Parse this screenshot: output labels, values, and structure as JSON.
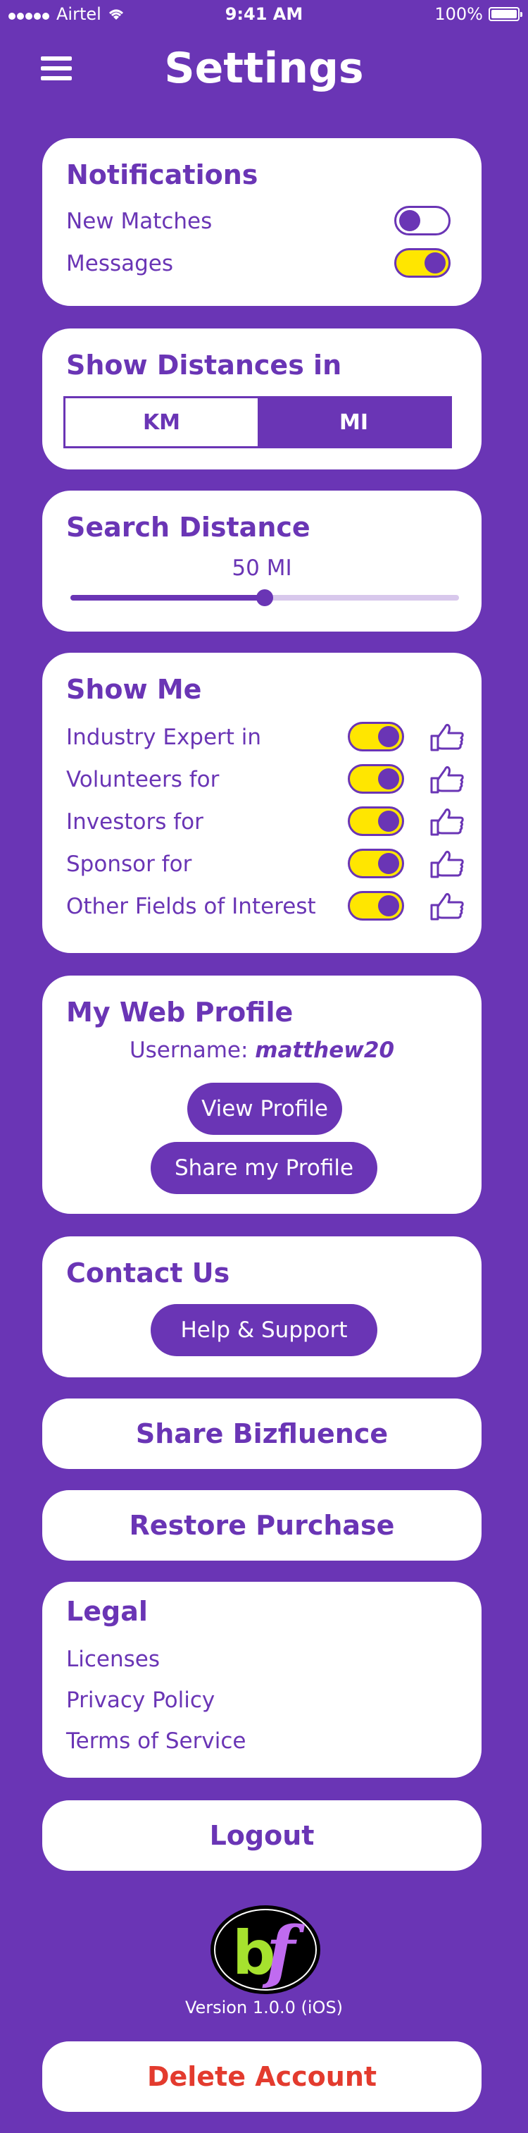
{
  "status_bar": {
    "carrier": "Airtel",
    "time": "9:41 AM",
    "battery": "100%"
  },
  "header": {
    "title": "Settings"
  },
  "notifications": {
    "title": "Notifications",
    "items": [
      {
        "label": "New Matches",
        "enabled": false
      },
      {
        "label": "Messages",
        "enabled": true
      }
    ]
  },
  "distance_units": {
    "title": "Show Distances in",
    "options": [
      "KM",
      "MI"
    ],
    "selected": "MI"
  },
  "search_distance": {
    "title": "Search Distance",
    "value_label": "50 MI",
    "fraction": 0.5
  },
  "show_me": {
    "title": "Show Me",
    "items": [
      {
        "label": "Industry Expert in",
        "enabled": true
      },
      {
        "label": "Volunteers for",
        "enabled": true
      },
      {
        "label": "Investors for",
        "enabled": true
      },
      {
        "label": "Sponsor for",
        "enabled": true
      },
      {
        "label": "Other Fields of Interest",
        "enabled": true
      }
    ]
  },
  "web_profile": {
    "title": "My Web Profile",
    "username_label": "Username:",
    "username": "matthew20",
    "view_label": "View Profile",
    "share_label": "Share my Profile"
  },
  "contact": {
    "title": "Contact Us",
    "help_label": "Help & Support"
  },
  "share_app_label": "Share Bizfluence",
  "restore_label": "Restore Purchase",
  "legal": {
    "title": "Legal",
    "links": [
      "Licenses",
      "Privacy Policy",
      "Terms of Service"
    ]
  },
  "logout_label": "Logout",
  "logo_text": "bf",
  "version": "Version 1.0.0 (iOS)",
  "delete_label": "Delete Account",
  "colors": {
    "primary": "#6a35b5",
    "toggle_on": "#ffe600",
    "danger": "#e33b2e",
    "logo_b": "#a6e22e",
    "logo_f": "#c06bf0"
  }
}
